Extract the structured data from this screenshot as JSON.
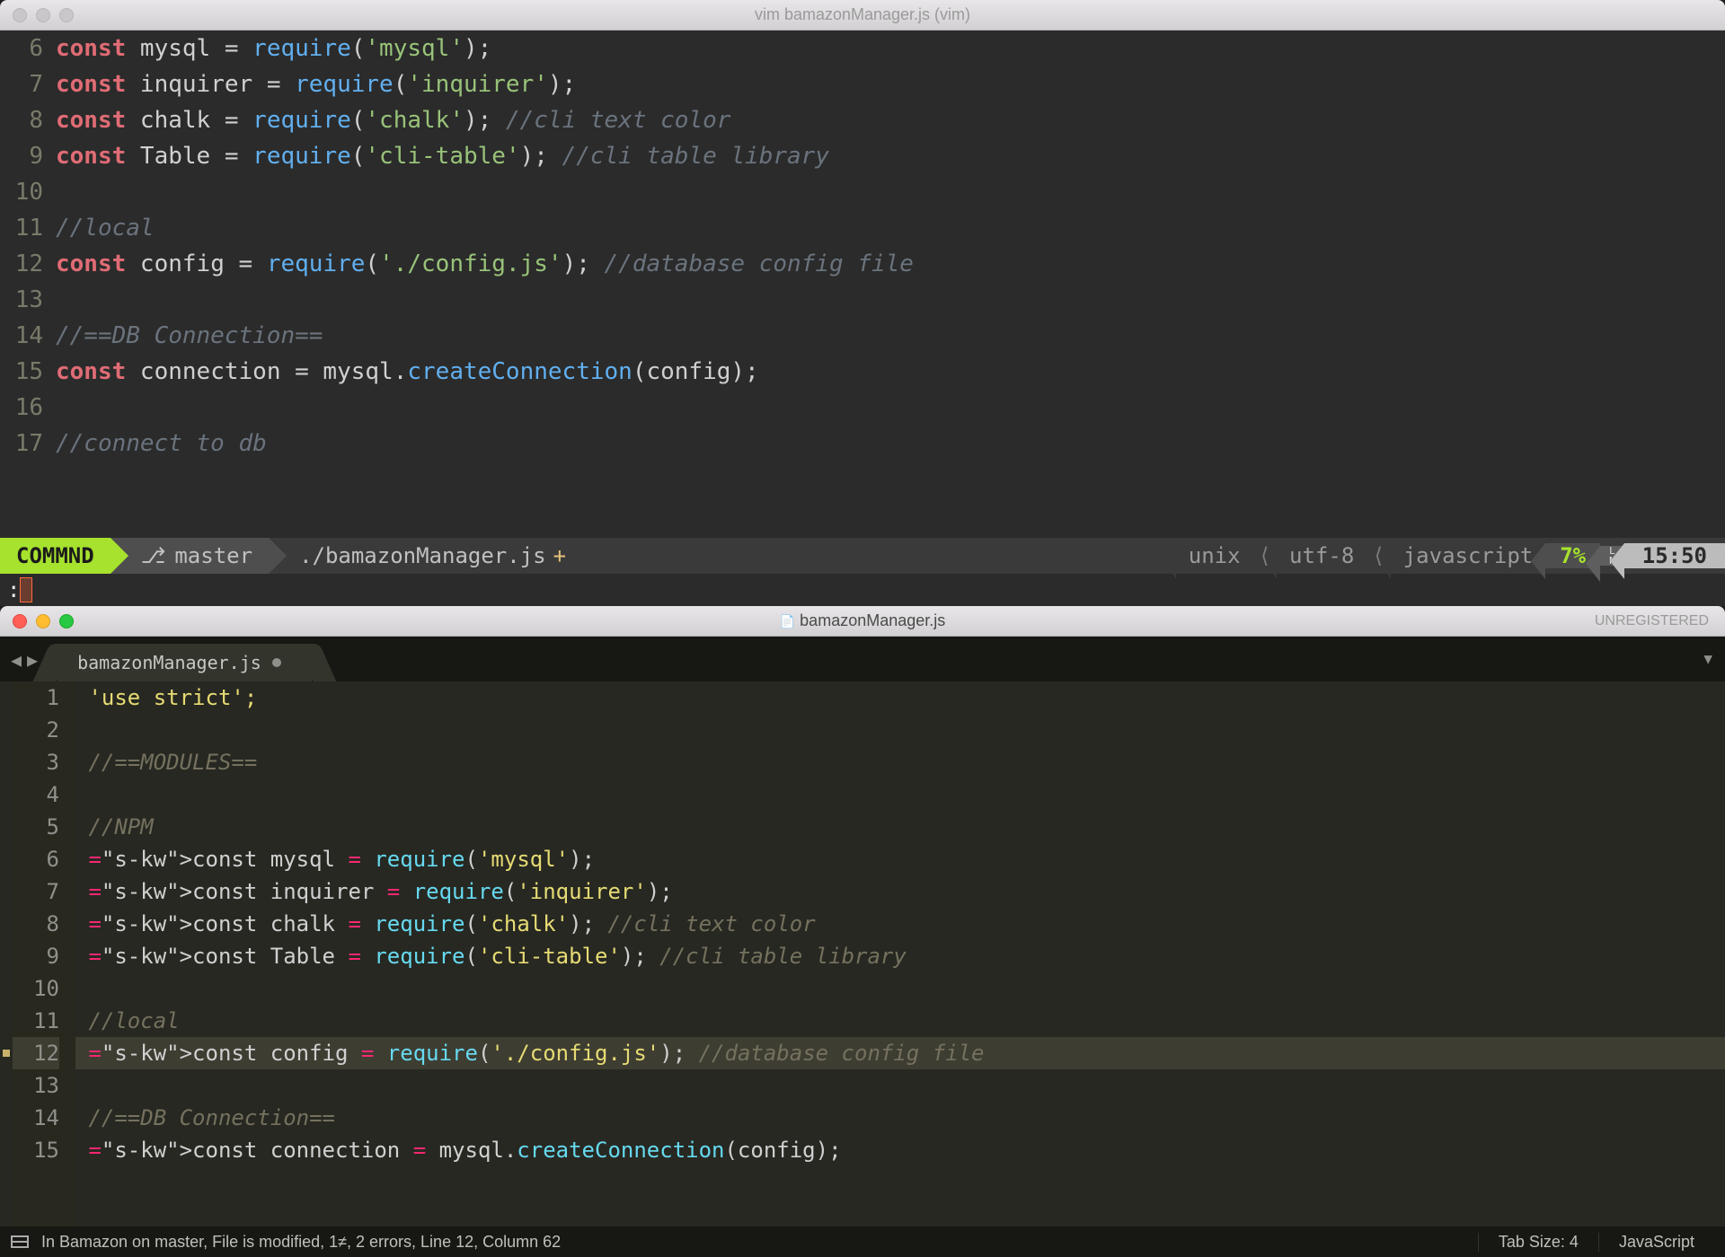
{
  "vim": {
    "title": "vim bamazonManager.js (vim)",
    "gutter_start": 6,
    "lines": [
      {
        "n": 6,
        "t": "const mysql = require('mysql');"
      },
      {
        "n": 7,
        "t": "const inquirer = require('inquirer');"
      },
      {
        "n": 8,
        "t": "const chalk = require('chalk'); //cli text color"
      },
      {
        "n": 9,
        "t": "const Table = require('cli-table'); //cli table library"
      },
      {
        "n": 10,
        "t": ""
      },
      {
        "n": 11,
        "t": "//local"
      },
      {
        "n": 12,
        "t": "const config = require('./config.js'); //database config file"
      },
      {
        "n": 13,
        "t": ""
      },
      {
        "n": 14,
        "t": "//==DB Connection=="
      },
      {
        "n": 15,
        "t": "const connection = mysql.createConnection(config);"
      },
      {
        "n": 16,
        "t": ""
      },
      {
        "n": 17,
        "t": "//connect to db"
      }
    ],
    "status": {
      "mode": "COMMND",
      "branch": "master",
      "file": "./bamazonManager.js",
      "modified": "+",
      "fileformat": "unix",
      "encoding": "utf-8",
      "filetype": "javascript",
      "percent": "7%",
      "ln_label": "L\nN",
      "position": "15:50"
    },
    "cmdline": ":"
  },
  "sublime": {
    "title": "bamazonManager.js",
    "registration": "UNREGISTERED",
    "tab": {
      "label": "bamazonManager.js",
      "dirty": true
    },
    "gutter_start": 1,
    "active_line": 12,
    "lines": [
      {
        "n": 1,
        "t": "'use strict';"
      },
      {
        "n": 2,
        "t": ""
      },
      {
        "n": 3,
        "t": "//==MODULES=="
      },
      {
        "n": 4,
        "t": ""
      },
      {
        "n": 5,
        "t": "//NPM"
      },
      {
        "n": 6,
        "t": "const mysql = require('mysql');"
      },
      {
        "n": 7,
        "t": "const inquirer = require('inquirer');"
      },
      {
        "n": 8,
        "t": "const chalk = require('chalk'); //cli text color"
      },
      {
        "n": 9,
        "t": "const Table = require('cli-table'); //cli table library"
      },
      {
        "n": 10,
        "t": ""
      },
      {
        "n": 11,
        "t": "//local"
      },
      {
        "n": 12,
        "t": "const config = require('./config.js'); //database config file"
      },
      {
        "n": 13,
        "t": ""
      },
      {
        "n": 14,
        "t": "//==DB Connection=="
      },
      {
        "n": 15,
        "t": "const connection = mysql.createConnection(config);"
      }
    ],
    "status": {
      "message": "In Bamazon on master, File is modified, 1≠, 2 errors, Line 12, Column 62",
      "tab_size": "Tab Size: 4",
      "syntax": "JavaScript"
    }
  }
}
